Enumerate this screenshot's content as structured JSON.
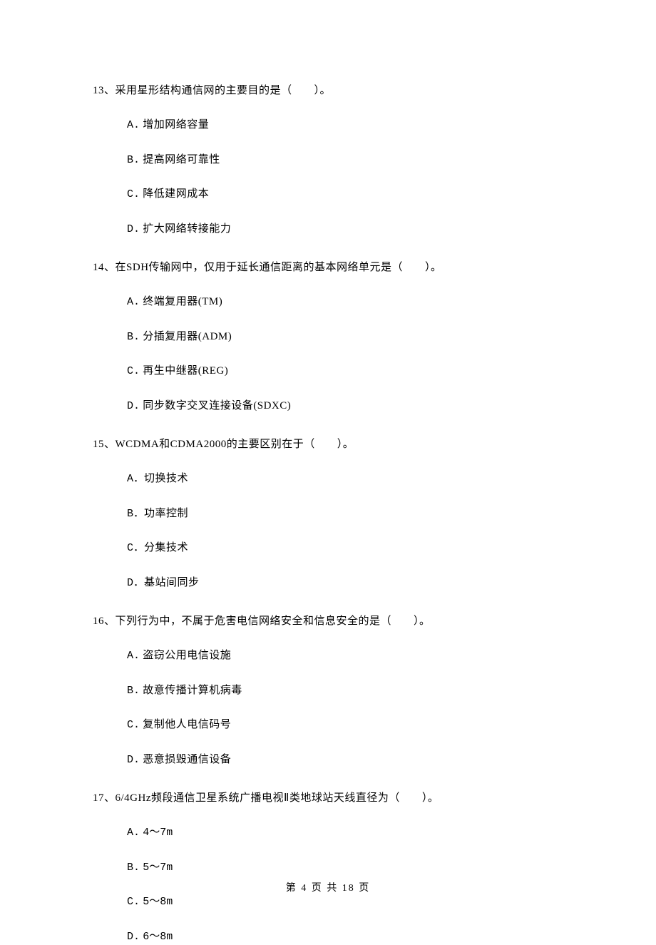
{
  "questions": [
    {
      "number": "13、",
      "text": "采用星形结构通信网的主要目的是（　　）。",
      "options": [
        {
          "letter": "A.",
          "text": "增加网络容量"
        },
        {
          "letter": "B.",
          "text": "提高网络可靠性"
        },
        {
          "letter": "C.",
          "text": "降低建网成本"
        },
        {
          "letter": "D.",
          "text": "扩大网络转接能力"
        }
      ]
    },
    {
      "number": "14、",
      "text": "在SDH传输网中，仅用于延长通信距离的基本网络单元是（　　）。",
      "options": [
        {
          "letter": "A.",
          "text": "终端复用器(TM)"
        },
        {
          "letter": "B.",
          "text": "分插复用器(ADM)"
        },
        {
          "letter": "C.",
          "text": "再生中继器(REG)"
        },
        {
          "letter": "D.",
          "text": "同步数字交叉连接设备(SDXC)"
        }
      ]
    },
    {
      "number": "15、",
      "text": "WCDMA和CDMA2000的主要区别在于（　　）。",
      "options": [
        {
          "letter": "A．",
          "text": "切换技术"
        },
        {
          "letter": "B．",
          "text": "功率控制"
        },
        {
          "letter": "C．",
          "text": "分集技术"
        },
        {
          "letter": "D．",
          "text": "基站间同步"
        }
      ]
    },
    {
      "number": "16、",
      "text": "下列行为中，不属于危害电信网络安全和信息安全的是（　　）。",
      "options": [
        {
          "letter": "A.",
          "text": "盗窃公用电信设施"
        },
        {
          "letter": "B.",
          "text": "故意传播计算机病毒"
        },
        {
          "letter": "C.",
          "text": "复制他人电信码号"
        },
        {
          "letter": "D.",
          "text": "恶意损毁通信设备"
        }
      ]
    },
    {
      "number": "17、",
      "text": "6/4GHz频段通信卫星系统广播电视Ⅱ类地球站天线直径为（　　）。",
      "options": [
        {
          "letter": "A.",
          "text": "4～7m"
        },
        {
          "letter": "B.",
          "text": "5～7m"
        },
        {
          "letter": "C.",
          "text": "5～8m"
        },
        {
          "letter": "D.",
          "text": "6～8m"
        }
      ]
    }
  ],
  "footer": "第 4 页 共 18 页"
}
